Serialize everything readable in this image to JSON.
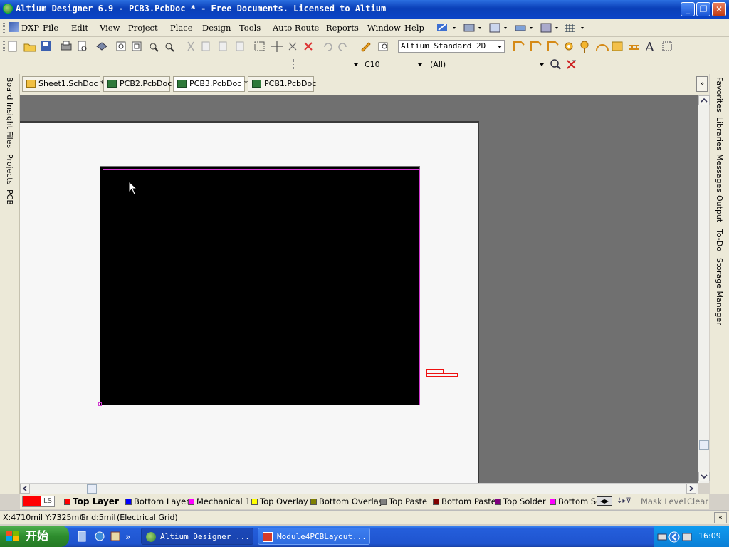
{
  "window": {
    "title": "Altium Designer 6.9 - PCB3.PcbDoc * - Free Documents. Licensed to Altium"
  },
  "menu": [
    "DXP",
    "File",
    "Edit",
    "View",
    "Project",
    "Place",
    "Design",
    "Tools",
    "Auto Route",
    "Reports",
    "Window",
    "Help"
  ],
  "toolbar": {
    "view_mode": "Altium Standard 2D",
    "filter1": "",
    "filter2": "C10",
    "filter3": "(All)"
  },
  "doc_tabs": [
    "Sheet1.SchDoc *",
    "PCB2.PcbDoc",
    "PCB3.PcbDoc *",
    "PCB1.PcbDoc"
  ],
  "left_panels": [
    "Board Insight",
    "Files",
    "Projects",
    "PCB"
  ],
  "right_panels": [
    "Favorites",
    "Libraries",
    "Messages",
    "Output",
    "To-Do",
    "Storage Manager"
  ],
  "layers": {
    "ls_label": "LS",
    "tabs": [
      {
        "label": "Top Layer",
        "color": "#ff0000",
        "active": true
      },
      {
        "label": "Bottom Layer",
        "color": "#0000ff"
      },
      {
        "label": "Mechanical 1",
        "color": "#ff00ff"
      },
      {
        "label": "Top Overlay",
        "color": "#ffff00"
      },
      {
        "label": "Bottom Overlay",
        "color": "#808000"
      },
      {
        "label": "Top Paste",
        "color": "#808080"
      },
      {
        "label": "Bottom Paste",
        "color": "#800000"
      },
      {
        "label": "Top Solder",
        "color": "#800080"
      },
      {
        "label": "Bottom Sol",
        "color": "#ff00ff"
      }
    ],
    "mask_level": "Mask Level",
    "clear": "Clear"
  },
  "status": {
    "coords": "X:4710mil Y:7325mil",
    "grid": "Grid:5mil",
    "grid_type": "(Electrical Grid)"
  },
  "taskbar": {
    "start": "开始",
    "tasks": [
      "Altium Designer ...",
      "Module4PCBLayout..."
    ],
    "clock": "16:09"
  }
}
